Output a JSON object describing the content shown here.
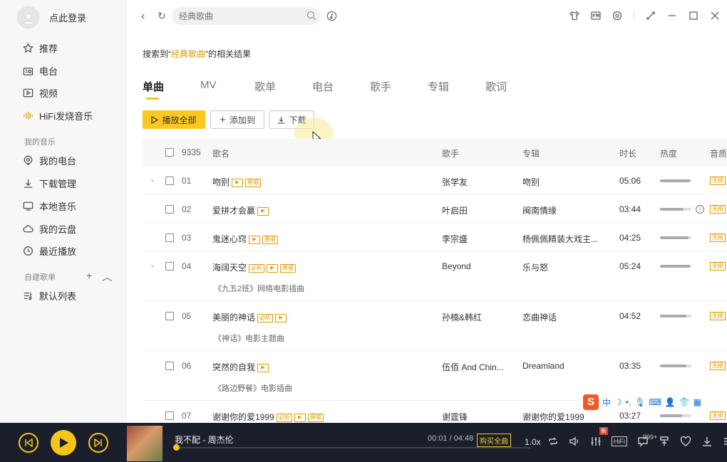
{
  "sidebar": {
    "login_text": "点此登录",
    "items": [
      {
        "label": "推荐",
        "icon": "star-icon"
      },
      {
        "label": "电台",
        "icon": "radio-icon"
      },
      {
        "label": "视频",
        "icon": "video-icon"
      },
      {
        "label": "HiFi发烧音乐",
        "icon": "soundwave-icon"
      }
    ],
    "my_music_title": "我的音乐",
    "my_items": [
      {
        "label": "我的电台",
        "icon": "location-radio-icon"
      },
      {
        "label": "下载管理",
        "icon": "download-icon"
      },
      {
        "label": "本地音乐",
        "icon": "monitor-icon"
      },
      {
        "label": "我的云盘",
        "icon": "cloud-icon"
      },
      {
        "label": "最近播放",
        "icon": "clock-icon"
      }
    ],
    "custom_title": "自建歌单",
    "custom_items": [
      {
        "label": "默认列表",
        "icon": "playlist-icon"
      }
    ]
  },
  "topbar": {
    "search_placeholder": "经典歌曲"
  },
  "result": {
    "prefix": "搜索到“",
    "keyword": "经典歌曲",
    "suffix": "”的相关结果"
  },
  "tabs": [
    "单曲",
    "MV",
    "歌单",
    "电台",
    "歌手",
    "专辑",
    "歌词"
  ],
  "actions": {
    "play_all": "播放全部",
    "add_to": "添加到",
    "download": "下载"
  },
  "table": {
    "count": "9335",
    "headers": {
      "name": "歌名",
      "singer": "歌手",
      "album": "专辑",
      "duration": "时长",
      "heat": "热度",
      "quality": "音质"
    },
    "rows": [
      {
        "num": "01",
        "title": "吻别",
        "singer": "张学友",
        "album": "吻别",
        "duration": "05:06",
        "heat": 0.95,
        "badges": [
          "mv",
          "原唱"
        ],
        "sub": "",
        "expandable": true
      },
      {
        "num": "02",
        "title": "爱拼才会赢",
        "singer": "叶启田",
        "album": "闽南情缘",
        "duration": "03:44",
        "heat": 0.75,
        "badges": [
          "mv"
        ],
        "sub": "",
        "expandable": false
      },
      {
        "num": "03",
        "title": "鬼迷心窍",
        "singer": "李宗盛",
        "album": "杨佩佩精装大戏主...",
        "duration": "04:25",
        "heat": 0.9,
        "badges": [
          "mv",
          "原唱"
        ],
        "sub": "",
        "expandable": false
      },
      {
        "num": "04",
        "title": "海阔天空",
        "singer": "Beyond",
        "album": "乐与怒",
        "duration": "05:24",
        "heat": 0.95,
        "badges": [
          "必听",
          "mv",
          "原唱"
        ],
        "sub": "《九五2班》网络电影插曲",
        "expandable": true
      },
      {
        "num": "05",
        "title": "美丽的神话",
        "singer": "孙楠&韩红",
        "album": "恋曲神话",
        "duration": "04:52",
        "heat": 0.85,
        "badges": [
          "必听",
          "mv"
        ],
        "sub": "《神话》电影主题曲",
        "expandable": false
      },
      {
        "num": "06",
        "title": "突然的自我",
        "singer": "伍佰 And Chin...",
        "album": "Dreamland",
        "duration": "03:35",
        "heat": 0.85,
        "badges": [
          "mv"
        ],
        "sub": "《路边野餐》电影插曲",
        "expandable": false
      },
      {
        "num": "07",
        "title": "谢谢你的爱1999",
        "singer": "谢霆锋",
        "album": "谢谢你的爱1999",
        "duration": "03:27",
        "heat": 0.7,
        "badges": [
          "必听",
          "mv",
          "原唱"
        ],
        "sub": "",
        "expandable": false
      }
    ],
    "quality_label": "无损"
  },
  "ime": {
    "labels": [
      "中"
    ]
  },
  "player": {
    "song": "我不配 - 周杰伦",
    "time": "00:01 / 04:48",
    "buy": "购买全曲",
    "speed": "1.0x",
    "new_badge": "新",
    "hifi": "HiFi",
    "comments": "999+",
    "progress": 0.004
  },
  "colors": {
    "accent": "#f5c518",
    "player_bg": "#1b1f2b"
  }
}
